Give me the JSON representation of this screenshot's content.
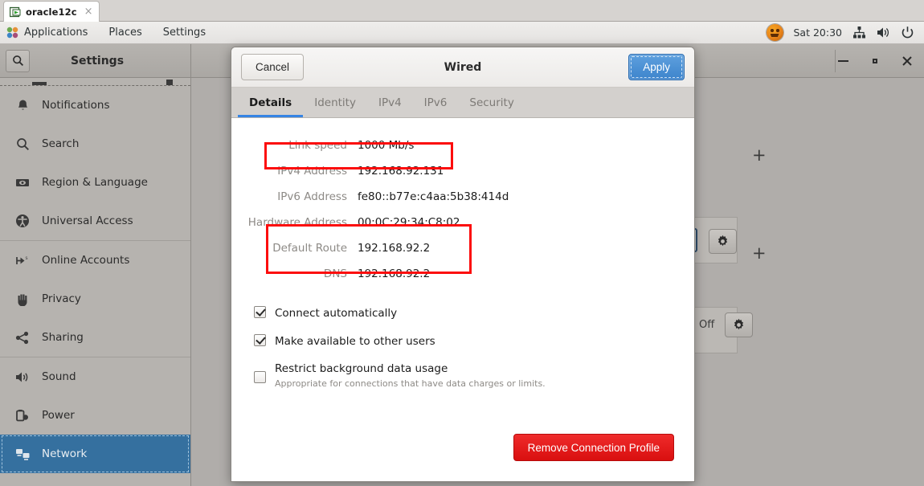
{
  "vm_tab": {
    "label": "oracle12c",
    "icon": "vm-play-icon",
    "close": "×"
  },
  "topbar": {
    "items": [
      "Applications",
      "Places",
      "Settings"
    ],
    "clock": "Sat 20:30",
    "tray_icons": [
      "pumpkin-icon",
      "network-wired-icon",
      "volume-icon",
      "power-icon"
    ]
  },
  "settings_window": {
    "title": "Settings",
    "search_icon": "search-icon",
    "window_buttons": [
      "minimize",
      "maximize",
      "close"
    ],
    "close_glyph": "×"
  },
  "sidebar": {
    "items": [
      {
        "label": "Notifications",
        "icon": "bell-icon",
        "selected": false
      },
      {
        "label": "Search",
        "icon": "search-icon",
        "selected": false
      },
      {
        "label": "Region & Language",
        "icon": "flag-icon",
        "selected": false
      },
      {
        "label": "Universal Access",
        "icon": "accessibility-icon",
        "selected": false
      },
      {
        "label": "Online Accounts",
        "icon": "online-accounts-icon",
        "selected": false
      },
      {
        "label": "Privacy",
        "icon": "hand-icon",
        "selected": false
      },
      {
        "label": "Sharing",
        "icon": "share-icon",
        "selected": false
      },
      {
        "label": "Sound",
        "icon": "speaker-icon",
        "selected": false
      },
      {
        "label": "Power",
        "icon": "battery-icon",
        "selected": false
      },
      {
        "label": "Network",
        "icon": "network-icon",
        "selected": true
      }
    ]
  },
  "main_panel": {
    "add_buttons": [
      "+",
      "+"
    ],
    "gear_icon": "gear-icon",
    "off_label": "Off"
  },
  "dialog": {
    "title": "Wired",
    "cancel_label": "Cancel",
    "apply_label": "Apply",
    "tabs": [
      {
        "label": "Details",
        "active": true
      },
      {
        "label": "Identity",
        "active": false
      },
      {
        "label": "IPv4",
        "active": false
      },
      {
        "label": "IPv6",
        "active": false
      },
      {
        "label": "Security",
        "active": false
      }
    ],
    "details": [
      {
        "label": "Link speed",
        "value": "1000 Mb/s"
      },
      {
        "label": "IPv4 Address",
        "value": "192.168.92.131"
      },
      {
        "label": "IPv6 Address",
        "value": "fe80::b77e:c4aa:5b38:414d"
      },
      {
        "label": "Hardware Address",
        "value": "00:0C:29:34:C8:02"
      },
      {
        "label": "Default Route",
        "value": "192.168.92.2"
      },
      {
        "label": "DNS",
        "value": "192.168.92.2"
      }
    ],
    "checkboxes": [
      {
        "label": "Connect automatically",
        "checked": true,
        "sub": ""
      },
      {
        "label": "Make available to other users",
        "checked": true,
        "sub": ""
      },
      {
        "label": "Restrict background data usage",
        "checked": false,
        "sub": "Appropriate for connections that have data charges or limits."
      }
    ],
    "remove_label": "Remove Connection Profile",
    "highlight_color": "#fc0d0d"
  }
}
